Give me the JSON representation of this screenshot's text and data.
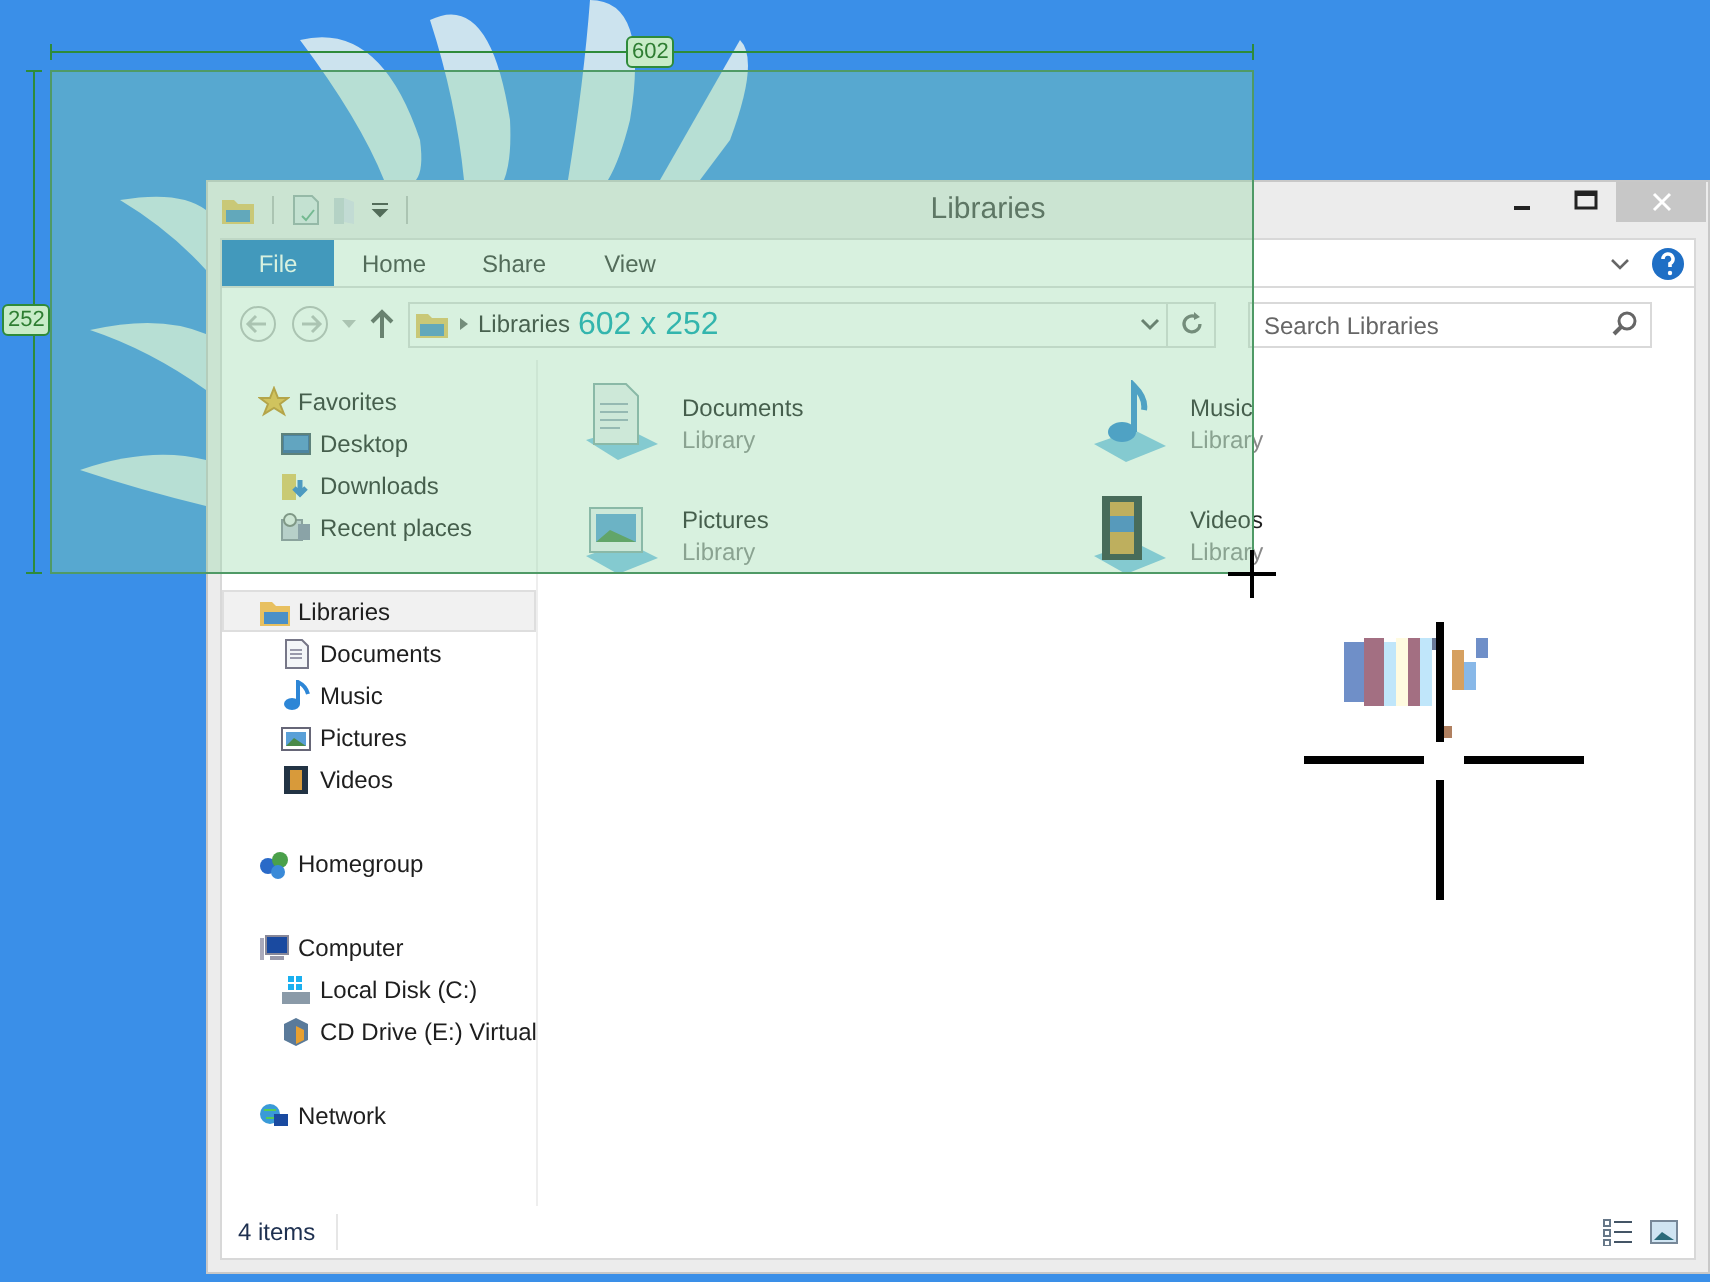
{
  "selection": {
    "width_label": "602",
    "height_label": "252",
    "size_label": "602 x 252"
  },
  "window": {
    "title": "Libraries"
  },
  "ribbon": {
    "file_tab": "File",
    "tabs": [
      "Home",
      "Share",
      "View"
    ]
  },
  "address": {
    "path": "Libraries"
  },
  "search": {
    "placeholder": "Search Libraries"
  },
  "nav": [
    {
      "label": "Favorites",
      "kind": "star",
      "selected": false,
      "children": [
        {
          "label": "Desktop",
          "kind": "desktop",
          "selected": false
        },
        {
          "label": "Downloads",
          "kind": "downloads",
          "selected": false
        },
        {
          "label": "Recent places",
          "kind": "recent",
          "selected": false
        }
      ]
    },
    {
      "label": "Libraries",
      "kind": "library",
      "selected": true,
      "children": [
        {
          "label": "Documents",
          "kind": "documents",
          "selected": false
        },
        {
          "label": "Music",
          "kind": "music",
          "selected": false
        },
        {
          "label": "Pictures",
          "kind": "pictures",
          "selected": false
        },
        {
          "label": "Videos",
          "kind": "videos",
          "selected": false
        }
      ]
    },
    {
      "label": "Homegroup",
      "kind": "homegroup",
      "selected": false
    },
    {
      "label": "Computer",
      "kind": "computer",
      "selected": false,
      "children": [
        {
          "label": "Local Disk (C:)",
          "kind": "disk",
          "selected": false
        },
        {
          "label": "CD Drive (E:) Virtual",
          "kind": "cd",
          "selected": false
        }
      ]
    },
    {
      "label": "Network",
      "kind": "network",
      "selected": false
    }
  ],
  "items": [
    {
      "name": "Documents",
      "type": "Library",
      "kind": "documents"
    },
    {
      "name": "Music",
      "type": "Library",
      "kind": "music"
    },
    {
      "name": "Pictures",
      "type": "Library",
      "kind": "pictures"
    },
    {
      "name": "Videos",
      "type": "Library",
      "kind": "videos"
    }
  ],
  "status_bar": {
    "count": "4 items"
  }
}
